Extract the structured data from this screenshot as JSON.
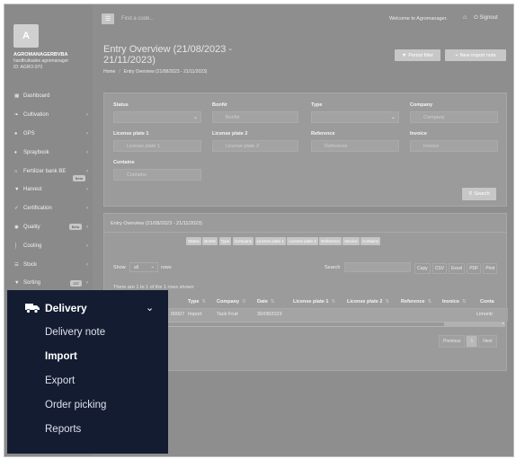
{
  "sidebar": {
    "avatar_letter": "A",
    "org_name": "AGROMANAGERBVBA",
    "org_sub": "hardfruitsales agromanager",
    "org_id": "ID: AGRO-970",
    "items": [
      {
        "icon": "dashboard-icon",
        "glyph": "▦",
        "label": "Dashboard",
        "chevron": "",
        "badge": ""
      },
      {
        "icon": "leaf-icon",
        "glyph": "❧",
        "label": "Cultivation",
        "chevron": "‹",
        "badge": ""
      },
      {
        "icon": "map-pin-icon",
        "glyph": "●",
        "label": "GPS",
        "chevron": "‹",
        "badge": ""
      },
      {
        "icon": "drop-icon",
        "glyph": "♦",
        "label": "Spraybook",
        "chevron": "‹",
        "badge": ""
      },
      {
        "icon": "bank-icon",
        "glyph": "⌂",
        "label": "Fertilizer bank BE",
        "chevron": "‹",
        "badge": "Beta"
      },
      {
        "icon": "basket-icon",
        "glyph": "▼",
        "label": "Harvest",
        "chevron": "‹",
        "badge": ""
      },
      {
        "icon": "certificate-icon",
        "glyph": "✓",
        "label": "Certification",
        "chevron": "‹",
        "badge": ""
      },
      {
        "icon": "quality-icon",
        "glyph": "◉",
        "label": "Quality",
        "chevron": "‹",
        "badge": "Beta"
      },
      {
        "icon": "thermometer-icon",
        "glyph": "│",
        "label": "Cooling",
        "chevron": "‹",
        "badge": ""
      },
      {
        "icon": "stock-icon",
        "glyph": "☰",
        "label": "Stock",
        "chevron": "‹",
        "badge": ""
      },
      {
        "icon": "filter-icon",
        "glyph": "▼",
        "label": "Sorting",
        "chevron": "‹",
        "badge": "237"
      }
    ]
  },
  "topbar": {
    "search_placeholder": "Find a code...",
    "welcome": "Welcome to Agromanager.",
    "signout": "Signout"
  },
  "header": {
    "title": "Entry Overview (21/08/2023 - 21/11/2023)",
    "breadcrumb_home": "Home",
    "breadcrumb_current": "Entry Overview (21/08/2023 - 21/11/2023)",
    "period_filter": "Period filter",
    "new_import": "New import note"
  },
  "filters": {
    "status_label": "Status",
    "status_value": "",
    "bonnr_label": "BonNr",
    "bonnr_placeholder": "BonNr",
    "type_label": "Type",
    "type_value": "",
    "company_label": "Company",
    "company_placeholder": "Company",
    "lp1_label": "License plate 1",
    "lp1_placeholder": "License plate 1",
    "lp2_label": "License plate 2",
    "lp2_placeholder": "License plate 2",
    "reference_label": "Reference",
    "reference_placeholder": "Reference",
    "invoice_label": "Invoice",
    "invoice_placeholder": "Invoice",
    "contains_label": "Contains",
    "contains_placeholder": "Contains",
    "search_button": "Search"
  },
  "results": {
    "title": "Entry Overview (21/08/2023 - 21/11/2023)",
    "column_toggles": [
      "Status",
      "BonNr",
      "Type",
      "Company",
      "License plate 1",
      "License plate 2",
      "Reference",
      "Invoice",
      "Contains"
    ],
    "show_label": "Show",
    "show_value": "all",
    "rows_label": "rows",
    "search_label": "Search",
    "exports": [
      "Copy",
      "CSV",
      "Excel",
      "PDF",
      "Print"
    ],
    "info": "There are 1 to 1 of the 1 rows shown",
    "headers": [
      "Type",
      "Company",
      "Date",
      "License plate 1",
      "License plate 2",
      "Reference",
      "Invoice",
      "Conta"
    ],
    "row": {
      "bonnr_tail": "00007",
      "type": "Import",
      "company": "Tack Fruit",
      "date": "30/08/2023",
      "lp1": "",
      "lp2": "",
      "reference": "",
      "invoice": "",
      "contains": "Limonti"
    },
    "pager": [
      "Previous",
      "1",
      "Next"
    ]
  },
  "delivery_menu": {
    "title": "Delivery",
    "items": [
      {
        "label": "Delivery note",
        "active": false
      },
      {
        "label": "Import",
        "active": true
      },
      {
        "label": "Export",
        "active": false
      },
      {
        "label": "Order picking",
        "active": false
      },
      {
        "label": "Reports",
        "active": false
      }
    ]
  }
}
